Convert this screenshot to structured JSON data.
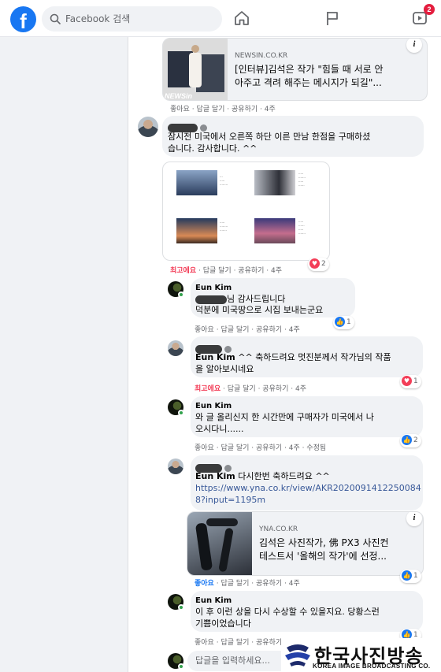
{
  "header": {
    "logo_letter": "f",
    "search_placeholder": "Facebook 검색",
    "watch_badge": "2"
  },
  "post_link_card": {
    "site": "NEWSIN.CO.KR",
    "title_line1": "[인터뷰]김석은 작가 \"힘들 때 서로 안",
    "title_line2": "아주고 격려 해주는 메시지가 되길\"...",
    "thumb_watermark": "NEWSin",
    "info": "i"
  },
  "comments": [
    {
      "text_line1": "잠시전 미국에서 오른쪽 하단 이른 만남 한점을 구매하셨",
      "text_line2": "습니다. 감사합니다. ^^",
      "actions": {
        "top": "최고에요",
        "reply": "답글 달기",
        "share": "공유하기",
        "time": "4주"
      },
      "reaction_count": "2"
    }
  ],
  "replies": [
    {
      "author": "Eun Kim",
      "text_line1": "님 감사드립니다",
      "text_line2": "덕분에 미국땅으로 시집 보내는군요",
      "actions": {
        "like": "좋아요",
        "reply": "답글 달기",
        "share": "공유하기",
        "time": "4주"
      },
      "reaction_count": "1"
    },
    {
      "mention": "Eun Kim",
      "text_line1": " ^^ 축하드려요 멋진분께서 작가님의 작품",
      "text_line2": "을 알아보시네요",
      "actions": {
        "top": "최고에요",
        "reply": "답글 달기",
        "share": "공유하기",
        "time": "4주"
      },
      "reaction_count": "1"
    },
    {
      "author": "Eun Kim",
      "text_line1": "와 글 올리신지 한 시간만에 구매자가 미국에서 나",
      "text_line2": "오시다니......",
      "actions": {
        "like": "좋아요",
        "reply": "답글 달기",
        "share": "공유하기",
        "time": "4주",
        "edited": "수정됨"
      },
      "reaction_count": "2"
    },
    {
      "mention": "Eun Kim",
      "text_line1": " 다시한번 축하드려요 ^^",
      "link_line1": "https://www.yna.co.kr/view/AKR2020091412250084",
      "link_line2": "8?input=1195m",
      "card": {
        "site": "YNA.CO.KR",
        "title_line1": "김석은 사진작가, 佛 PX3 사진컨",
        "title_line2": "테스트서 '올해의 작가'에 선정...",
        "info": "i"
      },
      "actions": {
        "like": "좋아요",
        "reply": "답글 달기",
        "share": "공유하기",
        "time": "4주"
      },
      "reaction_count": "1"
    },
    {
      "author": "Eun Kim",
      "text_line1": "이 후 이런 상을 다시 수상할 수 있을지요. 당황스런",
      "text_line2": "기쁨이었습니다",
      "actions": {
        "like": "좋아요",
        "reply": "답글 달기",
        "share": "공유하기",
        "time": "4주"
      },
      "reaction_count": "1"
    }
  ],
  "top_actions": {
    "like": "좋아요",
    "reply": "답글 달기",
    "share": "공유하기",
    "time": "4주"
  },
  "reply_input_placeholder": "답글을 입력하세요...",
  "watermark": {
    "korean": "한국사진방송",
    "english": "KOREA IMAGE BROADCASTING CO."
  }
}
